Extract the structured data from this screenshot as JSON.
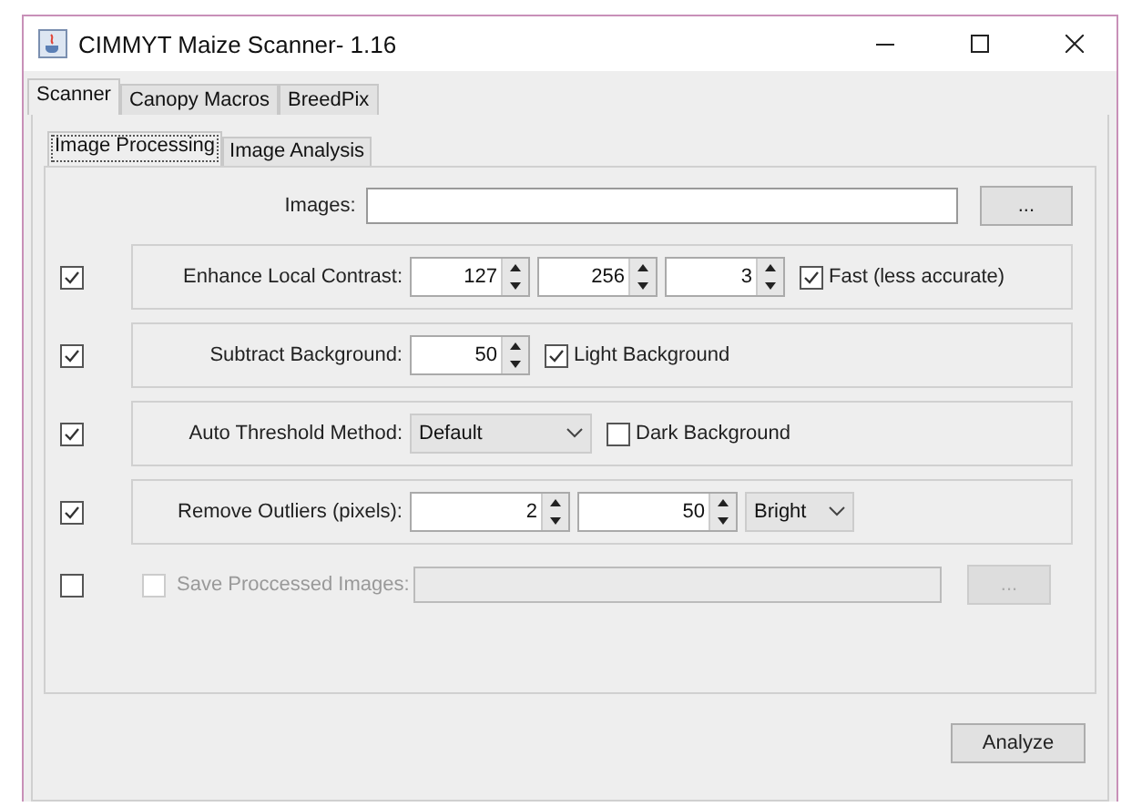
{
  "window": {
    "title": "CIMMYT Maize Scanner- 1.16"
  },
  "tabs": [
    {
      "label": "Scanner",
      "selected": true
    },
    {
      "label": "Canopy Macros",
      "selected": false
    },
    {
      "label": "BreedPix",
      "selected": false
    }
  ],
  "subtabs": [
    {
      "label": "Image Processing",
      "selected": true
    },
    {
      "label": "Image Analysis",
      "selected": false
    }
  ],
  "images": {
    "label": "Images:",
    "button": "..."
  },
  "steps": [
    {
      "checked": true,
      "label": "Enhance Local Contrast:",
      "controls": [
        {
          "kind": "spinner",
          "value": "127"
        },
        {
          "kind": "spinner",
          "value": "256"
        },
        {
          "kind": "spinner",
          "value": "3"
        },
        {
          "kind": "checkbox",
          "label": "Fast (less accurate)",
          "checked": true
        }
      ]
    },
    {
      "checked": true,
      "label": "Subtract Background:",
      "controls": [
        {
          "kind": "spinner",
          "value": "50"
        },
        {
          "kind": "checkbox",
          "label": "Light Background",
          "checked": true
        }
      ]
    },
    {
      "checked": true,
      "label": "Auto Threshold Method:",
      "controls": [
        {
          "kind": "dropdown",
          "value": "Default"
        },
        {
          "kind": "checkbox",
          "label": "Dark Background",
          "checked": false
        }
      ]
    },
    {
      "checked": true,
      "label": "Remove Outliers (pixels):",
      "controls": [
        {
          "kind": "wide-spinner",
          "value": "2"
        },
        {
          "kind": "wide-spinner",
          "value": "50"
        },
        {
          "kind": "small-dropdown",
          "value": "Bright"
        }
      ]
    }
  ],
  "save": {
    "checked": false,
    "disabled": true,
    "inner_checked": false,
    "label": "Save Proccessed Images:",
    "button": "..."
  },
  "action": {
    "label": "Analyze"
  }
}
